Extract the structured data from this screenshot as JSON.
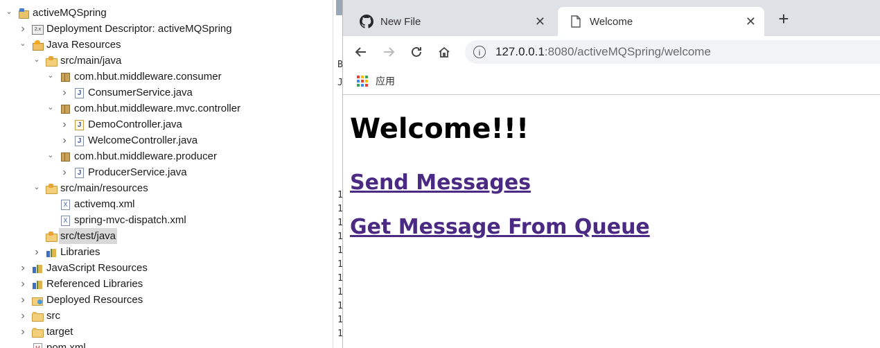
{
  "explorer": {
    "rows": [
      {
        "label": "activeMQSpring",
        "icon": "project-icon",
        "depth": 0,
        "expanded": true
      },
      {
        "label": "Deployment Descriptor: activeMQSpring",
        "icon": "deployment-descriptor-icon",
        "depth": 1,
        "expanded": false
      },
      {
        "label": "Java Resources",
        "icon": "java-resources-icon",
        "depth": 1,
        "expanded": true
      },
      {
        "label": "src/main/java",
        "icon": "source-folder-icon",
        "depth": 2,
        "expanded": true
      },
      {
        "label": "com.hbut.middleware.consumer",
        "icon": "package-icon",
        "depth": 3,
        "expanded": true
      },
      {
        "label": "ConsumerService.java",
        "icon": "java-file-icon",
        "depth": 4,
        "expanded": false
      },
      {
        "label": "com.hbut.middleware.mvc.controller",
        "icon": "package-icon",
        "depth": 3,
        "expanded": true
      },
      {
        "label": "DemoController.java",
        "icon": "java-file-warning-icon",
        "depth": 4,
        "expanded": false
      },
      {
        "label": "WelcomeController.java",
        "icon": "java-file-icon",
        "depth": 4,
        "expanded": false
      },
      {
        "label": "com.hbut.middleware.producer",
        "icon": "package-icon",
        "depth": 3,
        "expanded": true
      },
      {
        "label": "ProducerService.java",
        "icon": "java-file-icon",
        "depth": 4,
        "expanded": false
      },
      {
        "label": "src/main/resources",
        "icon": "source-folder-icon",
        "depth": 2,
        "expanded": true
      },
      {
        "label": "activemq.xml",
        "icon": "xml-file-icon",
        "depth": 3,
        "expanded": null
      },
      {
        "label": "spring-mvc-dispatch.xml",
        "icon": "xml-file-icon",
        "depth": 3,
        "expanded": null
      },
      {
        "label": "src/test/java",
        "icon": "source-folder-icon",
        "depth": 2,
        "expanded": null,
        "selected": true
      },
      {
        "label": "Libraries",
        "icon": "library-icon",
        "depth": 2,
        "expanded": false
      },
      {
        "label": "JavaScript Resources",
        "icon": "library-icon",
        "depth": 1,
        "expanded": false
      },
      {
        "label": "Referenced Libraries",
        "icon": "library-icon",
        "depth": 1,
        "expanded": false
      },
      {
        "label": "Deployed Resources",
        "icon": "deployed-resources-icon",
        "depth": 1,
        "expanded": false
      },
      {
        "label": "src",
        "icon": "folder-icon",
        "depth": 1,
        "expanded": false
      },
      {
        "label": "target",
        "icon": "folder-icon",
        "depth": 1,
        "expanded": false
      },
      {
        "label": "pom.xml",
        "icon": "pom-file-icon",
        "depth": 1,
        "expanded": null
      }
    ]
  },
  "midstrip": {
    "top_glyphs": [
      "B",
      "J"
    ],
    "line_numbers": [
      "1",
      "1",
      "1",
      "1",
      "1",
      "1",
      "1",
      "1",
      "1",
      "1",
      "1"
    ]
  },
  "browser": {
    "tabs": [
      {
        "title": "New File",
        "icon": "github-icon",
        "active": false
      },
      {
        "title": "Welcome",
        "icon": "page-icon",
        "active": true
      }
    ],
    "close_glyph": "✕",
    "new_tab_glyph": "+",
    "url_host": "127.0.0.1",
    "url_rest": ":8080/activeMQSpring/welcome",
    "bookmarks_apps_label": "应用",
    "colors": {
      "link": "#4b2a84",
      "tabstrip": "#dee1e6"
    }
  },
  "page": {
    "heading": "Welcome!!!",
    "links": [
      "Send Messages",
      "Get Message From Queue"
    ]
  }
}
